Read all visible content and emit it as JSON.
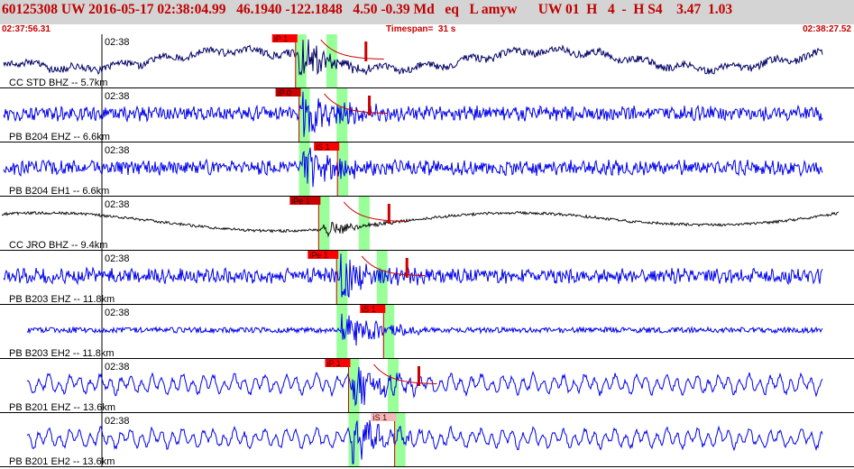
{
  "header": {
    "title": "60125308 UW 2016-05-17 02:38:04.99   46.1940 -122.1848   4.50 -0.39 Md   eq   L amyw      UW 01  H   4  -  H S4    3.47  1.03",
    "start_time": "02:37:56.31",
    "timespan": "Timespan=  31 s",
    "end_time": "02:38:27.52"
  },
  "colors": {
    "header_bg": "#d4d4d4",
    "header_text": "#c00000",
    "trace_blue": "#0000ee",
    "trace_navy": "#000066",
    "trace_black": "#111111",
    "pick_bg": "#ff0000",
    "pick_dark_bg": "#cc0000",
    "window_green": "#99ff99",
    "coda_curve": "#cc0000"
  },
  "channels": [
    {
      "label": "CC STD BHZ -- 5.7km",
      "tick": "02:38",
      "color": "navy",
      "style": "rumble",
      "picks": [
        {
          "label": "iP 1",
          "t": 0.344,
          "kind": "bright"
        }
      ],
      "windows": [
        0.344,
        0.38
      ],
      "coda": true
    },
    {
      "label": "PB B204 EHZ -- 6.6km",
      "tick": "02:38",
      "color": "blue",
      "style": "noise",
      "picks": [
        {
          "label": "iP 0",
          "t": 0.348,
          "kind": "dark"
        }
      ],
      "windows": [
        0.348,
        0.392
      ],
      "coda": true
    },
    {
      "label": "PB B204 EH1 -- 6.6km",
      "tick": "02:38",
      "color": "blue",
      "style": "noise",
      "picks": [
        {
          "label": "iS 1",
          "t": 0.393,
          "kind": "bright"
        }
      ],
      "windows": [
        0.348,
        0.393
      ],
      "coda": false
    },
    {
      "label": "CC JRO BHZ -- 9.4km",
      "tick": "02:38",
      "color": "black",
      "style": "long",
      "picks": [
        {
          "label": "iPe 1",
          "t": 0.371,
          "kind": "dark"
        }
      ],
      "windows": [
        0.371,
        0.418
      ],
      "coda": true
    },
    {
      "label": "PB B203 EHZ -- 11.8km",
      "tick": "02:38",
      "color": "blue",
      "style": "noise",
      "picks": [
        {
          "label": "iPe 1",
          "t": 0.392,
          "kind": "bright"
        }
      ],
      "windows": [
        0.392,
        0.439
      ],
      "coda": true
    },
    {
      "label": "PB B203 EH2 -- 11.8km",
      "tick": "02:38",
      "color": "blue",
      "style": "quiet",
      "picks": [
        {
          "label": "iS 1",
          "t": 0.447,
          "kind": "bright"
        }
      ],
      "windows": [
        0.392,
        0.447
      ],
      "coda": false
    },
    {
      "label": "PB B201 EHZ -- 13.6km",
      "tick": "02:38",
      "color": "blue",
      "style": "wavy",
      "picks": [
        {
          "label": "iP 1",
          "t": 0.406,
          "kind": "bright"
        }
      ],
      "windows": [
        0.406,
        0.452
      ],
      "coda": true
    },
    {
      "label": "PB B201 EH2 -- 13.6km",
      "tick": "02:38",
      "color": "blue",
      "style": "wavy",
      "picks": [
        {
          "label": "iS 1",
          "t": 0.46,
          "kind": "light"
        }
      ],
      "windows": [
        0.406,
        0.46
      ],
      "coda": false
    }
  ]
}
